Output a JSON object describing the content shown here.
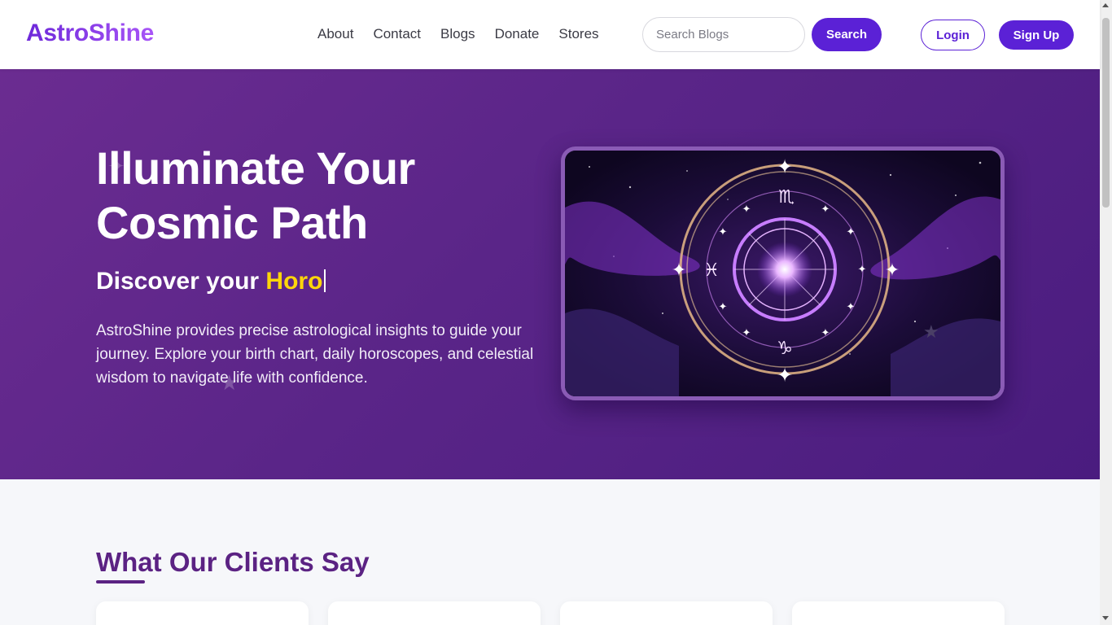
{
  "header": {
    "logo": "AstroShine",
    "nav": [
      "About",
      "Contact",
      "Blogs",
      "Donate",
      "Stores"
    ],
    "search_placeholder": "Search Blogs",
    "search_button": "Search",
    "login_button": "Login",
    "signup_button": "Sign Up"
  },
  "hero": {
    "title_line1": "Illuminate Your",
    "title_line2": "Cosmic Path",
    "subtitle_prefix": "Discover your ",
    "subtitle_highlight": "Horo",
    "description": "AstroShine provides precise astrological insights to guide your journey. Explore your birth chart, daily horoscopes, and celestial wisdom to navigate life with confidence.",
    "image_icon": "zodiac-wheel-illustration"
  },
  "testimonials": {
    "title": "What Our Clients Say"
  },
  "colors": {
    "primary": "#5b21d6",
    "hero_bg": "#5a2588",
    "highlight": "#ffd60a",
    "section_title": "#5b2283"
  }
}
